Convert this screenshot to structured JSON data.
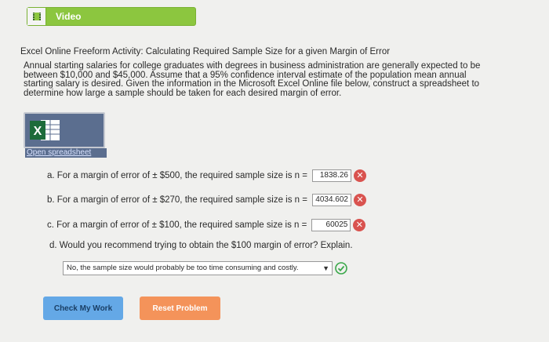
{
  "video": {
    "label": "Video",
    "icon": "film-icon"
  },
  "activity": {
    "title": "Excel Online Freeform Activity: Calculating Required Sample Size for a given Margin of Error",
    "paragraph_lines": [
      "Annual starting salaries for college graduates with degrees in business administration are generally expected to be",
      "between $10,000 and $45,000. Assume that a 95% confidence interval estimate of the population mean annual",
      "starting salary is desired. Given the information in the Microsoft Excel Online file below, construct a spreadsheet to",
      "determine how large a sample should be taken for each desired margin of error."
    ]
  },
  "spreadsheet": {
    "icon": "excel-icon",
    "link_text": "Open spreadsheet"
  },
  "questions": {
    "a": {
      "text": "a. For a margin of error of ± $500, the required sample size is n =",
      "answer": "1838.26",
      "status": "incorrect"
    },
    "b": {
      "text": "b. For a margin of error of ± $270, the required sample size is n =",
      "answer": "4034.602",
      "status": "incorrect"
    },
    "c": {
      "text": "c. For a margin of error of ± $100, the required sample size is n =",
      "answer": "60025",
      "status": "incorrect"
    },
    "d": {
      "text": "d. Would you recommend trying to obtain the $100 margin of error? Explain.",
      "selected": "No, the sample size would probably be too time consuming and costly.",
      "status": "correct"
    }
  },
  "buttons": {
    "check_label": "Check My Work",
    "reset_label": "Reset Problem"
  },
  "colors": {
    "video_green": "#8cc63f",
    "incorrect_red": "#d9534f",
    "correct_green": "#3aa84a",
    "check_blue": "#64a8e6",
    "reset_orange": "#f4935a"
  }
}
